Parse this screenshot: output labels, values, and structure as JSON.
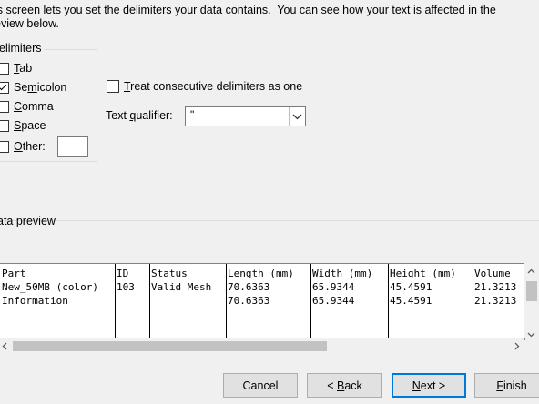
{
  "description": {
    "line1": "is screen lets you set the delimiters your data contains.  You can see how your text is affected in the",
    "line2": "eview below."
  },
  "delimiters": {
    "label": "elimiters",
    "items": [
      {
        "label": "Tab",
        "checked": false
      },
      {
        "label": "Semicolon",
        "checked": true
      },
      {
        "label": "Comma",
        "checked": false
      },
      {
        "label": "Space",
        "checked": false
      },
      {
        "label": "Other:",
        "checked": false
      }
    ],
    "other_value": ""
  },
  "consecutive": {
    "label": "Treat consecutive delimiters as one",
    "checked": false
  },
  "text_qualifier": {
    "label": "Text qualifier:",
    "value": "\""
  },
  "data_preview": {
    "label": "ata preview",
    "columns": [
      {
        "rows": [
          "Part",
          "New_50MB (color)",
          "Information"
        ]
      },
      {
        "rows": [
          "ID",
          "103",
          ""
        ]
      },
      {
        "rows": [
          "Status",
          "Valid Mesh",
          ""
        ]
      },
      {
        "rows": [
          "Length (mm)",
          "70.6363",
          "70.6363"
        ]
      },
      {
        "rows": [
          "Width (mm)",
          "65.9344",
          "65.9344"
        ]
      },
      {
        "rows": [
          "Height (mm)",
          "45.4591",
          "45.4591"
        ]
      },
      {
        "rows": [
          "Volume",
          "21.3213",
          "21.3213"
        ]
      }
    ]
  },
  "buttons": {
    "cancel": "Cancel",
    "back": "< Back",
    "next": "Next >",
    "finish": "Finish"
  },
  "icons": {
    "dropdown": "chevron-down-icon",
    "scroll_left": "chevron-left-icon",
    "scroll_right": "chevron-right-icon",
    "scroll_up": "chevron-up-icon",
    "scroll_down": "chevron-down-icon"
  }
}
